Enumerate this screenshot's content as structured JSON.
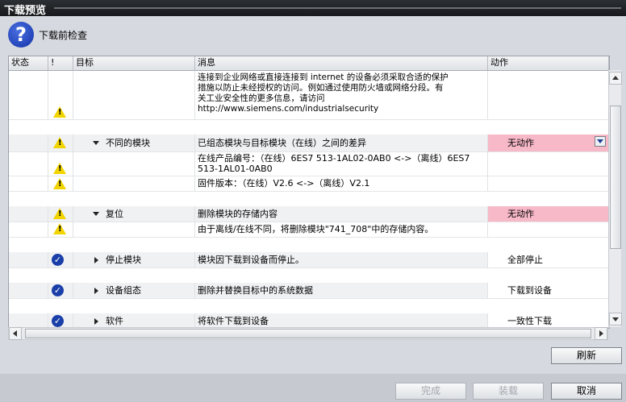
{
  "window": {
    "title": "下载预览"
  },
  "header": {
    "title": "下载前检查",
    "icon": "question-icon"
  },
  "columns": {
    "status": "状态",
    "bang": "!",
    "target": "目标",
    "message": "消息",
    "action": "动作"
  },
  "rows": {
    "security": {
      "message": "连接到企业网络或直接连接到 internet 的设备必须采取合适的保护\n措施以防止未经授权的访问。例如通过使用防火墙或网络分段。有\n关工业安全性的更多信息，请访问\nhttp://www.siemens.com/industrialsecurity"
    },
    "diff": {
      "target": "不同的模块",
      "message": "已组态模块与目标模块（在线）之间的差异",
      "action": "无动作"
    },
    "product": {
      "message": "在线产品编号：（在线）6ES7 513-1AL02-0AB0 <->（离线）6ES7\n513-1AL01-0AB0"
    },
    "firmware": {
      "message": "固件版本：（在线）V2.6 <->（离线）V2.1"
    },
    "reset": {
      "target": "复位",
      "message": "删除模块的存储内容",
      "action": "无动作"
    },
    "reset_info": {
      "message": "由于离线/在线不同，将删除模块\"741_708\"中的存储内容。"
    },
    "stop": {
      "target": "停止模块",
      "message": "模块因下载到设备而停止。",
      "action": "全部停止"
    },
    "config": {
      "target": "设备组态",
      "message": "删除并替换目标中的系统数据",
      "action": "下载到设备"
    },
    "software": {
      "target": "软件",
      "message": "将软件下载到设备",
      "action": "一致性下载"
    }
  },
  "buttons": {
    "refresh": "刷新",
    "finish": "完成",
    "load": "装载",
    "cancel": "取消"
  },
  "colors": {
    "warning": "#f2d400",
    "ok": "#1b3fa8",
    "pink": "#f7b8c8"
  }
}
